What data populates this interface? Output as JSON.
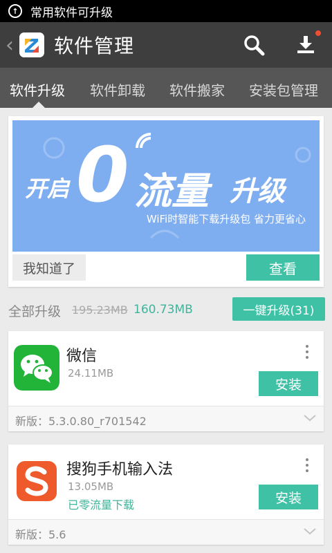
{
  "status_bar": {
    "notification_text": "常用软件可升级",
    "icon": "upgrade-icon"
  },
  "header": {
    "title": "软件管理",
    "back_icon": "back-chevron-icon",
    "app_icon": "app-logo-icon",
    "search_icon": "search-icon",
    "download_icon": "download-icon",
    "badge_color": "#f04e30"
  },
  "tabs": [
    {
      "label": "软件升级",
      "active": true
    },
    {
      "label": "软件卸载",
      "active": false
    },
    {
      "label": "软件搬家",
      "active": false
    },
    {
      "label": "安装包管理",
      "active": false
    }
  ],
  "banner": {
    "headline_parts": [
      "开启",
      "0",
      "流量",
      "升级"
    ],
    "subtitle": "WiFi时智能下载升级包 省力更省心",
    "dismiss_label": "我知道了",
    "view_label": "查看"
  },
  "summary": {
    "label": "全部升级",
    "old_size": "195.23MB",
    "new_size": "160.73MB",
    "update_all_label": "一键升级(31)"
  },
  "apps": [
    {
      "name": "微信",
      "size": "24.11MB",
      "note": "",
      "install_label": "安装",
      "version": "新版：5.3.0.80_r701542",
      "icon": "wechat-icon"
    },
    {
      "name": "搜狗手机输入法",
      "size": "13.05MB",
      "note": "已零流量下载",
      "install_label": "安装",
      "version": "新版：5.6",
      "icon": "sogou-icon"
    }
  ],
  "colors": {
    "accent": "#3fc1a6",
    "header_bg": "#3e3e3e",
    "tab_bg": "#565656",
    "banner_bg": "#7faef0"
  }
}
